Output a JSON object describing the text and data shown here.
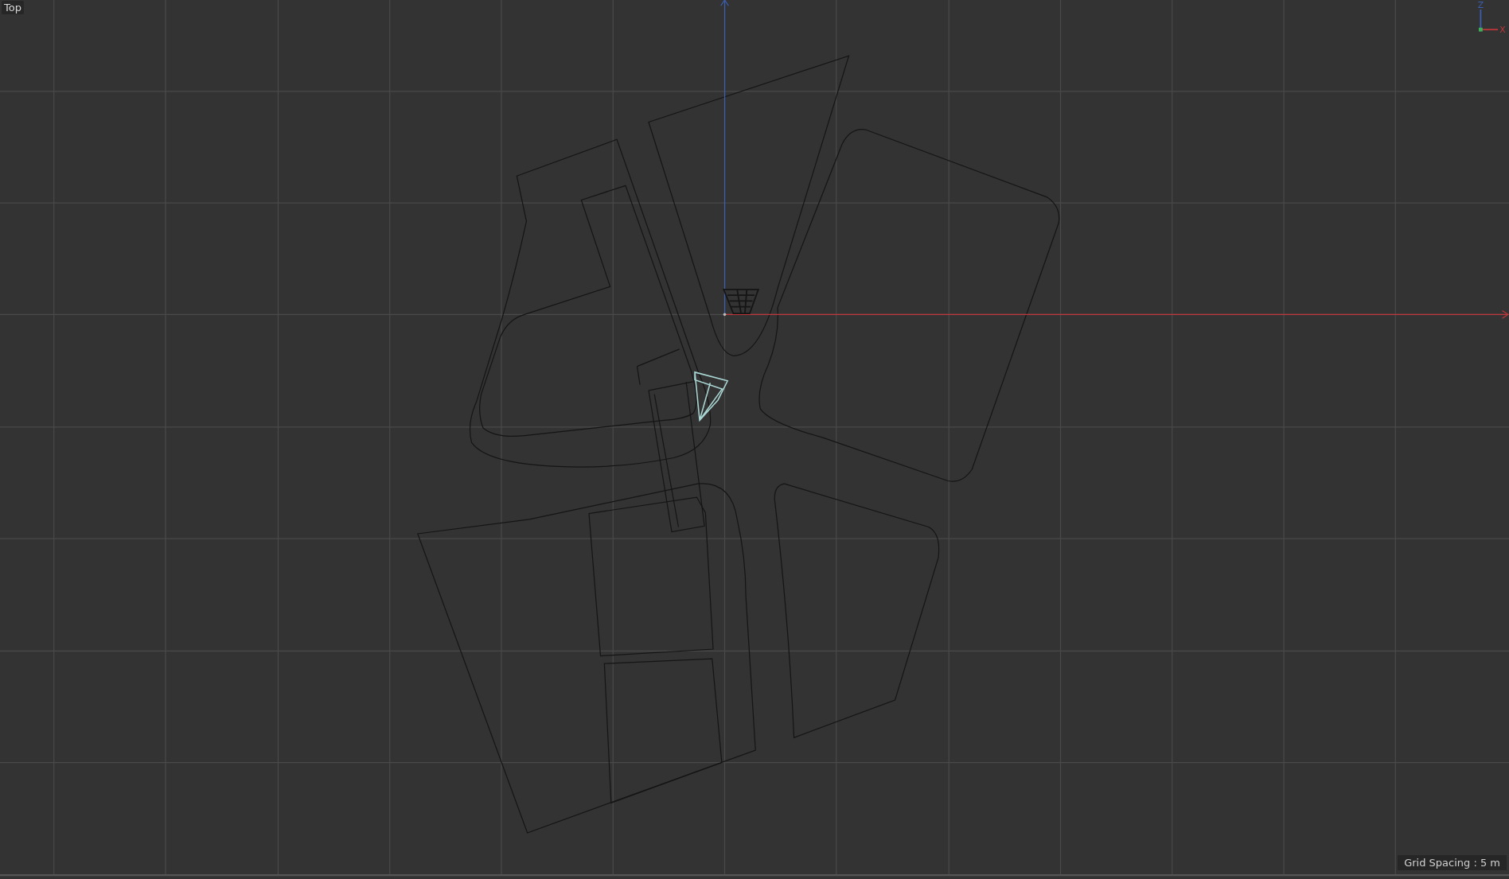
{
  "viewport": {
    "title": "Top",
    "axis_gizmo": {
      "labels": [
        "Z",
        "X"
      ]
    },
    "grid_spacing": "Grid Spacing : 5 m"
  }
}
